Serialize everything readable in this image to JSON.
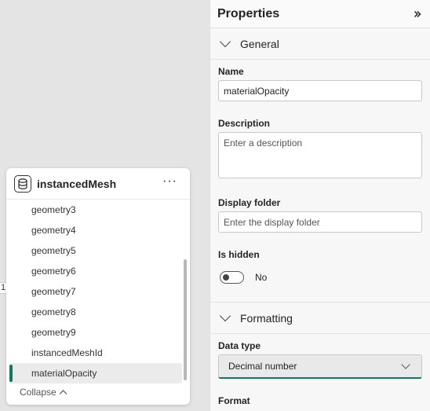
{
  "canvas": {
    "edge_marker": "1",
    "table": {
      "title": "instancedMesh",
      "more_label": "···",
      "fields": [
        "geometry3",
        "geometry4",
        "geometry5",
        "geometry6",
        "geometry7",
        "geometry8",
        "geometry9",
        "instancedMeshId",
        "materialOpacity"
      ],
      "selected_field": "materialOpacity",
      "collapse_label": "Collapse"
    }
  },
  "properties": {
    "title": "Properties",
    "close_icon": "double-chevron-right-icon",
    "general": {
      "heading": "General",
      "name_label": "Name",
      "name_value": "materialOpacity",
      "description_label": "Description",
      "description_placeholder": "Enter a description",
      "display_folder_label": "Display folder",
      "display_folder_placeholder": "Enter the display folder",
      "is_hidden_label": "Is hidden",
      "is_hidden_value": "No"
    },
    "formatting": {
      "heading": "Formatting",
      "data_type_label": "Data type",
      "data_type_value": "Decimal number",
      "format_label": "Format"
    }
  },
  "colors": {
    "accent": "#117865"
  }
}
